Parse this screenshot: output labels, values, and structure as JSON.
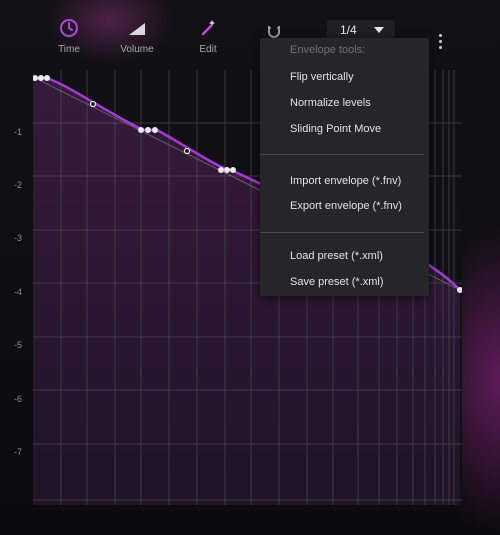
{
  "toolbar": {
    "time_label": "Time",
    "volume_label": "Volume",
    "edit_label": "Edit",
    "snap_value": "1/4",
    "icons": {
      "time": "clock-icon",
      "volume": "volume-ramp-icon",
      "edit": "magic-wand-icon",
      "snap": "magnet-icon",
      "more": "more-vertical-icon",
      "dropdown": "caret-down-icon"
    },
    "accent_color": "#a94bd6"
  },
  "y_axis": {
    "ticks": [
      "-1",
      "-2",
      "-3",
      "-4",
      "-5",
      "-6",
      "-7"
    ]
  },
  "menu": {
    "header": "Envelope tools:",
    "items": [
      "Flip vertically",
      "Normalize levels",
      "Sliding Point Move",
      "Import envelope (*.fnv)",
      "Export envelope (*.fnv)",
      "Load preset (*.xml)",
      "Save preset (*.xml)"
    ]
  },
  "colors": {
    "curve": "#a53ad6",
    "fill": "#3a1b3f",
    "point": "#eaeaf0",
    "menu_bg": "#262629"
  }
}
